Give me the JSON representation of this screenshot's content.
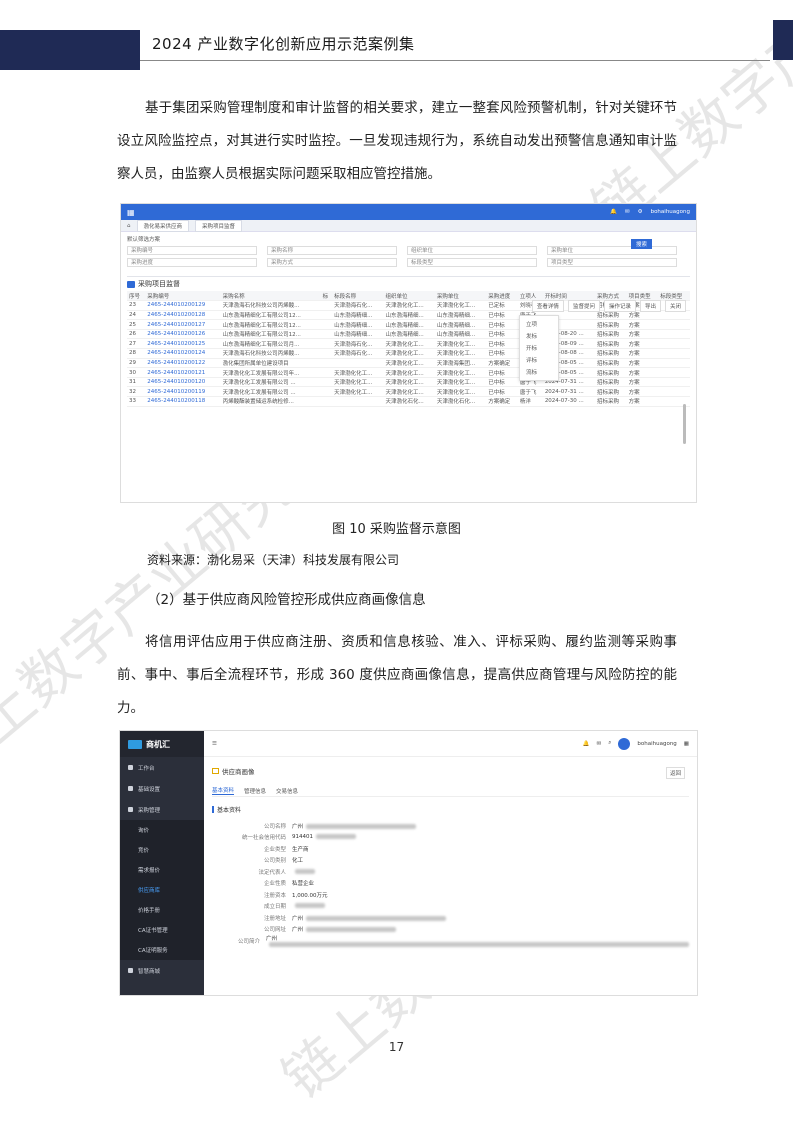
{
  "header": {
    "title": "2024 产业数字化创新应用示范案例集"
  },
  "paragraph1": "基于集团采购管理制度和审计监督的相关要求，建立一整套风险预警机制，针对关键环节设立风险监控点，对其进行实时监控。一旦发现违规行为，系统自动发出预警信息通知审计监察人员，由监察人员根据实际问题采取相应管控措施。",
  "figure": {
    "caption": "图 10  采购监督示意图",
    "source": "资料来源：渤化易采（天津）科技发展有限公司"
  },
  "subheading": "（2）基于供应商风险管控形成供应商画像信息",
  "paragraph2": "将信用评估应用于供应商注册、资质和信息核验、准入、评标采购、履约监测等采购事前、事中、事后全流程环节，形成 360 度供应商画像信息，提高供应商管理与风险防控的能力。",
  "page_number": "17",
  "watermark": "链上数字产业研究院",
  "screenshot1": {
    "user": "bohaihuagong",
    "tabs": [
      "渤化易采供应商",
      "采购项目监督"
    ],
    "filter_label": "默认筛选方案",
    "filters_row1": [
      "采购编号",
      "采购名称",
      "组织单位",
      "采购单位"
    ],
    "filters_row2": [
      "采购进度",
      "采购方式",
      "标段类型",
      "项目类型"
    ],
    "search_btn": "搜索",
    "panel_title": "采购项目监督",
    "panel_buttons": [
      "查看详情",
      "监督提问",
      "操作记录",
      "导出",
      "关闭"
    ],
    "dropdown": [
      "立项",
      "发标",
      "开标",
      "评标",
      "流标"
    ],
    "columns": [
      "序号",
      "采购编号",
      "采购名称",
      "标",
      "标段名称",
      "组织单位",
      "采购单位",
      "采购进度",
      "立项人",
      "开标时间",
      "采购方式",
      "项目类型",
      "标段类型"
    ],
    "rows": [
      [
        "23",
        "2465-244010200129",
        "天津渤海石化科技公司丙烯酸...",
        "",
        "天津渤海石化...",
        "天津渤化化工...",
        "天津渤化化工...",
        "已定标",
        "刘晓春",
        "",
        "招标采购",
        "方案",
        ""
      ],
      [
        "24",
        "2465-244010200128",
        "山东渤海精细化工有限公司12...",
        "",
        "山东渤海精细...",
        "山东渤海精细...",
        "山东渤海精细...",
        "已中标",
        "唐于飞",
        "",
        "招标采购",
        "方案",
        ""
      ],
      [
        "25",
        "2465-244010200127",
        "山东渤海精细化工有限公司12...",
        "",
        "山东渤海精细...",
        "山东渤海精细...",
        "山东渤海精细...",
        "已中标",
        "唐于飞",
        "",
        "招标采购",
        "方案",
        ""
      ],
      [
        "26",
        "2465-244010200126",
        "山东渤海精细化工有限公司12...",
        "",
        "山东渤海精细...",
        "山东渤海精细...",
        "山东渤海精细...",
        "已中标",
        "唐于飞",
        "2024-08-20 ...",
        "招标采购",
        "方案",
        ""
      ],
      [
        "27",
        "2465-244010200125",
        "山东渤海精细化工有限公司月...",
        "",
        "天津渤海石化...",
        "天津渤化化工...",
        "天津渤化化工...",
        "已中标",
        "唐于飞",
        "2024-08-09 ...",
        "招标采购",
        "方案",
        ""
      ],
      [
        "28",
        "2465-244010200124",
        "天津渤海石化科技公司丙烯酸...",
        "",
        "天津渤海石化...",
        "天津渤化化工...",
        "天津渤化化工...",
        "已中标",
        "杨洋",
        "2024-08-08 ...",
        "招标采购",
        "方案",
        ""
      ],
      [
        "29",
        "2465-244010200122",
        "渤化集团所属单位建设项目",
        "",
        "",
        "天津渤化化工...",
        "天津渤海集团...",
        "方案确定",
        "唐于飞",
        "2024-08-05 ...",
        "招标采购",
        "方案",
        ""
      ],
      [
        "30",
        "2465-244010200121",
        "天津渤化化工发展有限公司年...",
        "",
        "天津渤化化工...",
        "天津渤化化工...",
        "天津渤化化工...",
        "已中标",
        "刘晓春",
        "2024-08-05 ...",
        "招标采购",
        "方案",
        ""
      ],
      [
        "31",
        "2465-244010200120",
        "天津渤化化工发展有限公司 ...",
        "",
        "天津渤化化工...",
        "天津渤化化工...",
        "天津渤化化工...",
        "已中标",
        "唐于飞",
        "2024-07-31 ...",
        "招标采购",
        "方案",
        ""
      ],
      [
        "32",
        "2465-244010200119",
        "天津渤化化工发展有限公司 ...",
        "",
        "天津渤化化工...",
        "天津渤化化工...",
        "天津渤化化工...",
        "已中标",
        "唐于飞",
        "2024-07-31 ...",
        "招标采购",
        "方案",
        ""
      ],
      [
        "33",
        "2465-244010200118",
        "丙烯酸酯装置储运系统检修...",
        "",
        "",
        "天津渤化石化...",
        "天津渤化石化...",
        "方案确定",
        "杨洋",
        "2024-07-30 ...",
        "招标采购",
        "方案",
        ""
      ]
    ]
  },
  "screenshot2": {
    "logo": "商机汇",
    "user": "bohaihuagong",
    "menu": [
      {
        "label": "工作台",
        "level": 1
      },
      {
        "label": "基础设置",
        "level": 1
      },
      {
        "label": "采购管理",
        "level": 1
      },
      {
        "label": "询价",
        "level": 2
      },
      {
        "label": "竞价",
        "level": 2
      },
      {
        "label": "需求报价",
        "level": 2
      },
      {
        "label": "供应商库",
        "level": 2,
        "active": true
      },
      {
        "label": "价格手册",
        "level": 2
      },
      {
        "label": "CA证书管理",
        "level": 2
      },
      {
        "label": "CA证明服务",
        "level": 2
      },
      {
        "label": "智慧商城",
        "level": 1
      }
    ],
    "page_title": "供应商画像",
    "back": "返回",
    "tabs": [
      "基本资料",
      "管理信息",
      "交易信息"
    ],
    "section": "基本资料",
    "fields": [
      {
        "k": "公司名称",
        "v": "广州"
      },
      {
        "k": "统一社会信用代码",
        "v": "914401"
      },
      {
        "k": "企业类型",
        "v": "生产商"
      },
      {
        "k": "公司类别",
        "v": "化工"
      },
      {
        "k": "法定代表人",
        "v": ""
      },
      {
        "k": "企业性质",
        "v": "私营企业"
      },
      {
        "k": "注册资本",
        "v": "1,000.00万元"
      },
      {
        "k": "成立日期",
        "v": ""
      },
      {
        "k": "注册地址",
        "v": "广州"
      },
      {
        "k": "公司网址",
        "v": "广州"
      },
      {
        "k": "公司简介",
        "v": "广州"
      }
    ]
  }
}
